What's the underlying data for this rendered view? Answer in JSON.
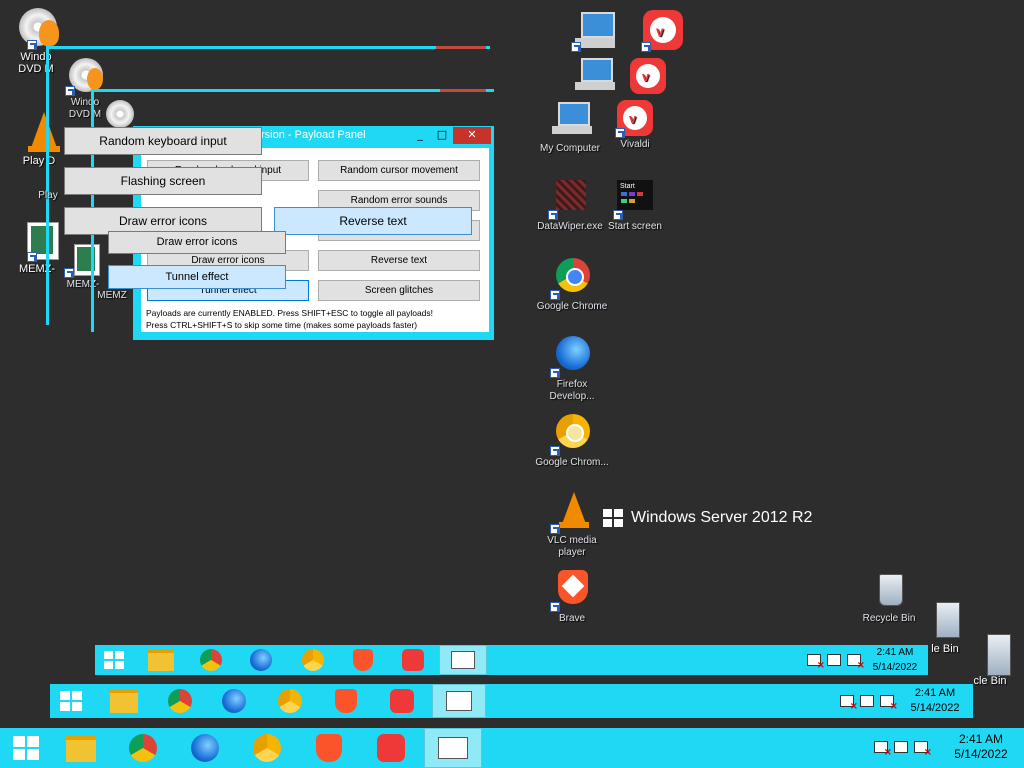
{
  "desktop": {
    "icons_left": [
      {
        "label": "Windo DVD M",
        "icon": "dvd-maker-icon"
      },
      {
        "label": "Windo DVD M",
        "icon": "dvd-maker-icon"
      },
      {
        "label": "Play D",
        "icon": "vlc-icon"
      },
      {
        "label": "Play",
        "icon": "vlc-icon"
      },
      {
        "label": "MEMZ-",
        "icon": "memz-icon"
      },
      {
        "label": "MEMZ-",
        "icon": "memz-icon"
      },
      {
        "label": "MEMZ",
        "icon": "memz-icon"
      }
    ],
    "icons_right": [
      {
        "label": "My Computer",
        "icon": "computer-icon"
      },
      {
        "label": "Vivaldi",
        "icon": "vivaldi-icon"
      },
      {
        "label": "DataWiper.exe",
        "icon": "datawiper-icon"
      },
      {
        "label": "Start screen",
        "icon": "start-screen-icon"
      },
      {
        "label": "Google Chrome",
        "icon": "chrome-icon"
      },
      {
        "label": "Firefox Develop...",
        "icon": "firefox-dev-icon"
      },
      {
        "label": "Google Chrom...",
        "icon": "chrome-canary-icon"
      },
      {
        "label": "VLC media player",
        "icon": "vlc-icon"
      },
      {
        "label": "Brave",
        "icon": "brave-icon"
      },
      {
        "label": "Recycle Bin",
        "icon": "recycle-bin-icon"
      },
      {
        "label": "le Bin",
        "icon": "recycle-bin-icon"
      },
      {
        "label": "cle Bin",
        "icon": "recycle-bin-icon"
      }
    ],
    "start_screen_tile_label": "Start",
    "watermark": "Windows Server 2012 R2"
  },
  "payload_panel": {
    "title_fragment": "rsion - Payload Panel",
    "title_controls": [
      "_",
      "□",
      "✕"
    ],
    "buttons": [
      {
        "label": "Random keyboard input",
        "active": false
      },
      {
        "label": "Random cursor movement",
        "active": false
      },
      {
        "label": "Random error sounds",
        "active": false
      },
      {
        "label": "Reverse text",
        "active": true
      },
      {
        "label": "Draw error icons",
        "active": true
      },
      {
        "label": "Reverse text",
        "active": false
      },
      {
        "label": "Tunnel effect",
        "active": true
      },
      {
        "label": "Screen glitches",
        "active": false
      },
      {
        "label": "Flashing screen",
        "active": false
      }
    ],
    "status_line_1": "Payloads are currently ENABLED. Press SHIFT+ESC to toggle all payloads!",
    "status_line_2": "Press CTRL+SHIFT+S to skip some time (makes some payloads faster)"
  },
  "floating_buttons": {
    "random_keyboard_input": "Random keyboard input",
    "flashing_screen": "Flashing screen",
    "draw_error_icons": "Draw error icons",
    "reverse_text": "Reverse text",
    "draw_error_icons_2": "Draw error icons",
    "tunnel_effect": "Tunnel effect"
  },
  "taskbar": {
    "pinned": [
      "file-explorer-icon",
      "chrome-icon",
      "firefox-dev-icon",
      "chrome-canary-icon",
      "brave-icon",
      "vivaldi-icon",
      "memz-panel-icon"
    ],
    "time": "2:41 AM",
    "date": "5/14/2022",
    "tray": [
      "action-center-flag-icon",
      "network-icon",
      "volume-muted-icon"
    ]
  },
  "colors": {
    "desktop": "#2d2d2d",
    "glitch_cyan": "#1fd8f4",
    "glitch_red": "#c04a3c",
    "active_button": "#cce8ff"
  }
}
